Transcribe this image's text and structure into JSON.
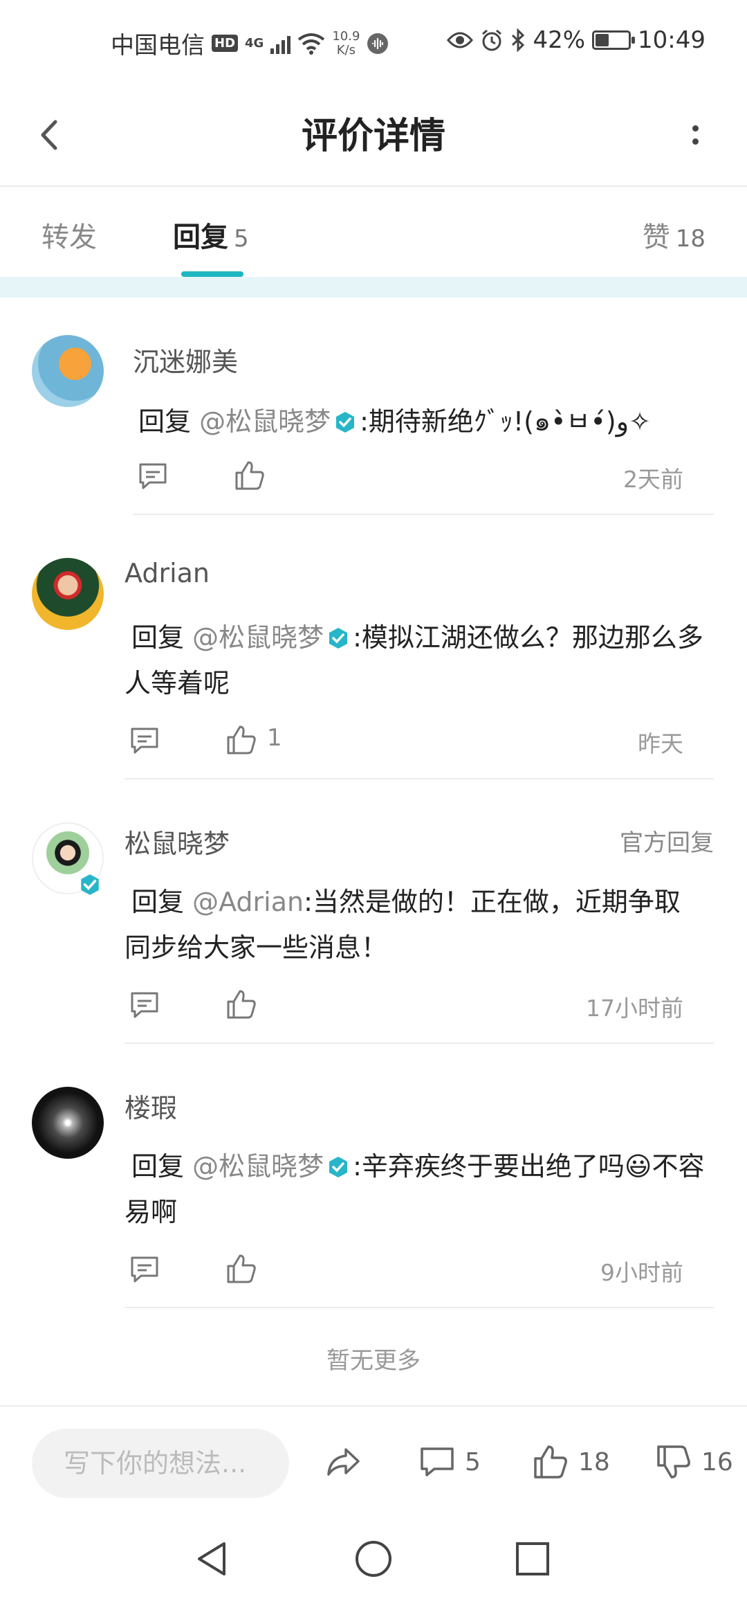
{
  "status_bar": {
    "carrier": "中国电信",
    "hd": "HD",
    "network": "4G",
    "speed_value": "10.9",
    "speed_unit": "K/s",
    "battery": "42%",
    "battery_level": 0.42,
    "time": "10:49"
  },
  "header": {
    "title": "评价详情"
  },
  "tabs": {
    "forward": {
      "label": "转发"
    },
    "reply": {
      "label": "回复",
      "count": "5"
    },
    "like": {
      "label": "赞",
      "count": "18"
    },
    "accent": "#1fb5c2"
  },
  "comments": [
    {
      "user": "沉迷娜美",
      "prefix": "回复",
      "mention": "@松鼠晓梦",
      "verified": true,
      "text": ":期待新绝ｸﾞｯ!(๑•̀ㅂ•́)و✧",
      "like_count": "",
      "time": "2天前"
    },
    {
      "user": "Adrian",
      "prefix": "回复",
      "mention": "@松鼠晓梦",
      "verified": true,
      "text": ":模拟江湖还做么？那边那么多人等着呢",
      "like_count": "1",
      "time": "昨天"
    },
    {
      "user": "松鼠晓梦",
      "official_label": "官方回复",
      "prefix": "回复",
      "mention": "@Adrian",
      "verified": false,
      "text": ":当然是做的！正在做，近期争取同步给大家一些消息！",
      "like_count": "",
      "time": "17小时前"
    },
    {
      "user": "楼瑕",
      "prefix": "回复",
      "mention": "@松鼠晓梦",
      "verified": true,
      "text": ":辛弃疾终于要出绝了吗😃不容易啊",
      "like_count": "",
      "time": "9小时前"
    }
  ],
  "footer_note": "暂无更多",
  "bottom_bar": {
    "input_placeholder": "写下你的想法...",
    "comment_count": "5",
    "like_count": "18",
    "dislike_count": "16"
  },
  "icons": {
    "comment": "comment-icon",
    "like": "thumbs-up-icon",
    "dislike": "thumbs-down-icon",
    "share": "share-icon",
    "verified": "verified-badge-icon"
  }
}
